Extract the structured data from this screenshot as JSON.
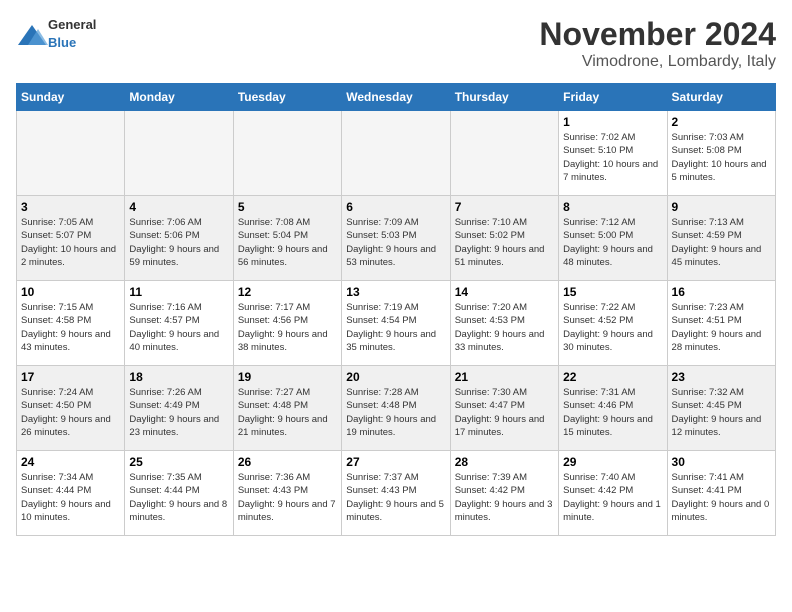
{
  "logo": {
    "general": "General",
    "blue": "Blue"
  },
  "title": "November 2024",
  "location": "Vimodrone, Lombardy, Italy",
  "days_of_week": [
    "Sunday",
    "Monday",
    "Tuesday",
    "Wednesday",
    "Thursday",
    "Friday",
    "Saturday"
  ],
  "weeks": [
    [
      {
        "day": "",
        "info": "",
        "empty": true
      },
      {
        "day": "",
        "info": "",
        "empty": true
      },
      {
        "day": "",
        "info": "",
        "empty": true
      },
      {
        "day": "",
        "info": "",
        "empty": true
      },
      {
        "day": "",
        "info": "",
        "empty": true
      },
      {
        "day": "1",
        "info": "Sunrise: 7:02 AM\nSunset: 5:10 PM\nDaylight: 10 hours and 7 minutes.",
        "empty": false
      },
      {
        "day": "2",
        "info": "Sunrise: 7:03 AM\nSunset: 5:08 PM\nDaylight: 10 hours and 5 minutes.",
        "empty": false
      }
    ],
    [
      {
        "day": "3",
        "info": "Sunrise: 7:05 AM\nSunset: 5:07 PM\nDaylight: 10 hours and 2 minutes.",
        "empty": false
      },
      {
        "day": "4",
        "info": "Sunrise: 7:06 AM\nSunset: 5:06 PM\nDaylight: 9 hours and 59 minutes.",
        "empty": false
      },
      {
        "day": "5",
        "info": "Sunrise: 7:08 AM\nSunset: 5:04 PM\nDaylight: 9 hours and 56 minutes.",
        "empty": false
      },
      {
        "day": "6",
        "info": "Sunrise: 7:09 AM\nSunset: 5:03 PM\nDaylight: 9 hours and 53 minutes.",
        "empty": false
      },
      {
        "day": "7",
        "info": "Sunrise: 7:10 AM\nSunset: 5:02 PM\nDaylight: 9 hours and 51 minutes.",
        "empty": false
      },
      {
        "day": "8",
        "info": "Sunrise: 7:12 AM\nSunset: 5:00 PM\nDaylight: 9 hours and 48 minutes.",
        "empty": false
      },
      {
        "day": "9",
        "info": "Sunrise: 7:13 AM\nSunset: 4:59 PM\nDaylight: 9 hours and 45 minutes.",
        "empty": false
      }
    ],
    [
      {
        "day": "10",
        "info": "Sunrise: 7:15 AM\nSunset: 4:58 PM\nDaylight: 9 hours and 43 minutes.",
        "empty": false
      },
      {
        "day": "11",
        "info": "Sunrise: 7:16 AM\nSunset: 4:57 PM\nDaylight: 9 hours and 40 minutes.",
        "empty": false
      },
      {
        "day": "12",
        "info": "Sunrise: 7:17 AM\nSunset: 4:56 PM\nDaylight: 9 hours and 38 minutes.",
        "empty": false
      },
      {
        "day": "13",
        "info": "Sunrise: 7:19 AM\nSunset: 4:54 PM\nDaylight: 9 hours and 35 minutes.",
        "empty": false
      },
      {
        "day": "14",
        "info": "Sunrise: 7:20 AM\nSunset: 4:53 PM\nDaylight: 9 hours and 33 minutes.",
        "empty": false
      },
      {
        "day": "15",
        "info": "Sunrise: 7:22 AM\nSunset: 4:52 PM\nDaylight: 9 hours and 30 minutes.",
        "empty": false
      },
      {
        "day": "16",
        "info": "Sunrise: 7:23 AM\nSunset: 4:51 PM\nDaylight: 9 hours and 28 minutes.",
        "empty": false
      }
    ],
    [
      {
        "day": "17",
        "info": "Sunrise: 7:24 AM\nSunset: 4:50 PM\nDaylight: 9 hours and 26 minutes.",
        "empty": false
      },
      {
        "day": "18",
        "info": "Sunrise: 7:26 AM\nSunset: 4:49 PM\nDaylight: 9 hours and 23 minutes.",
        "empty": false
      },
      {
        "day": "19",
        "info": "Sunrise: 7:27 AM\nSunset: 4:48 PM\nDaylight: 9 hours and 21 minutes.",
        "empty": false
      },
      {
        "day": "20",
        "info": "Sunrise: 7:28 AM\nSunset: 4:48 PM\nDaylight: 9 hours and 19 minutes.",
        "empty": false
      },
      {
        "day": "21",
        "info": "Sunrise: 7:30 AM\nSunset: 4:47 PM\nDaylight: 9 hours and 17 minutes.",
        "empty": false
      },
      {
        "day": "22",
        "info": "Sunrise: 7:31 AM\nSunset: 4:46 PM\nDaylight: 9 hours and 15 minutes.",
        "empty": false
      },
      {
        "day": "23",
        "info": "Sunrise: 7:32 AM\nSunset: 4:45 PM\nDaylight: 9 hours and 12 minutes.",
        "empty": false
      }
    ],
    [
      {
        "day": "24",
        "info": "Sunrise: 7:34 AM\nSunset: 4:44 PM\nDaylight: 9 hours and 10 minutes.",
        "empty": false
      },
      {
        "day": "25",
        "info": "Sunrise: 7:35 AM\nSunset: 4:44 PM\nDaylight: 9 hours and 8 minutes.",
        "empty": false
      },
      {
        "day": "26",
        "info": "Sunrise: 7:36 AM\nSunset: 4:43 PM\nDaylight: 9 hours and 7 minutes.",
        "empty": false
      },
      {
        "day": "27",
        "info": "Sunrise: 7:37 AM\nSunset: 4:43 PM\nDaylight: 9 hours and 5 minutes.",
        "empty": false
      },
      {
        "day": "28",
        "info": "Sunrise: 7:39 AM\nSunset: 4:42 PM\nDaylight: 9 hours and 3 minutes.",
        "empty": false
      },
      {
        "day": "29",
        "info": "Sunrise: 7:40 AM\nSunset: 4:42 PM\nDaylight: 9 hours and 1 minute.",
        "empty": false
      },
      {
        "day": "30",
        "info": "Sunrise: 7:41 AM\nSunset: 4:41 PM\nDaylight: 9 hours and 0 minutes.",
        "empty": false
      }
    ]
  ]
}
